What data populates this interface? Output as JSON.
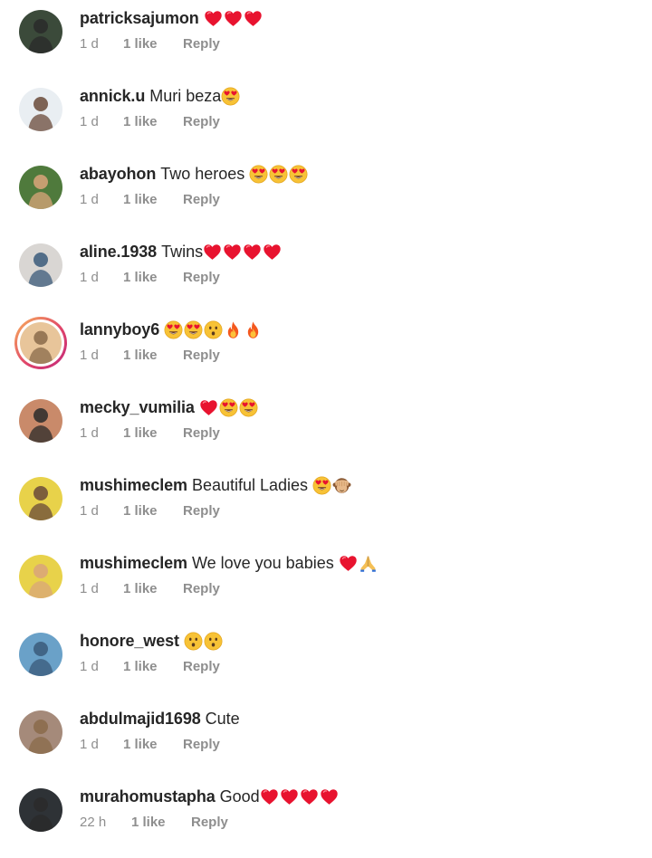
{
  "comments": [
    {
      "username": "patricksajumon",
      "text": "",
      "emojis": [
        "red-heart",
        "red-heart",
        "red-heart"
      ],
      "time": "1 d",
      "likes": "1 like",
      "reply": "Reply",
      "avatar_color": "#3b4a3a",
      "story": false
    },
    {
      "username": "annick.u",
      "text": "Muri beza",
      "emojis": [
        "heart-eyes"
      ],
      "time": "1 d",
      "likes": "1 like",
      "reply": "Reply",
      "avatar_color": "#e9eef2",
      "story": false
    },
    {
      "username": "abayohon",
      "text": "Two heroes",
      "emojis": [
        "heart-eyes",
        "heart-eyes",
        "heart-eyes"
      ],
      "time": "1 d",
      "likes": "1 like",
      "reply": "Reply",
      "avatar_color": "#4f7a3c",
      "story": false
    },
    {
      "username": "aline.1938",
      "text": "Twins",
      "emojis": [
        "red-heart",
        "red-heart",
        "red-heart",
        "red-heart"
      ],
      "time": "1 d",
      "likes": "1 like",
      "reply": "Reply",
      "avatar_color": "#d9d6d3",
      "story": false
    },
    {
      "username": "lannyboy6",
      "text": "",
      "emojis": [
        "heart-eyes",
        "heart-eyes",
        "hushed",
        "fire",
        "fire"
      ],
      "time": "1 d",
      "likes": "1 like",
      "reply": "Reply",
      "avatar_color": "#e8c59a",
      "story": true
    },
    {
      "username": "mecky_vumilia",
      "text": "",
      "emojis": [
        "red-heart",
        "heart-eyes",
        "heart-eyes"
      ],
      "time": "1 d",
      "likes": "1 like",
      "reply": "Reply",
      "avatar_color": "#c98a6a",
      "story": false
    },
    {
      "username": "mushimeclem",
      "text": "Beautiful Ladies",
      "emojis": [
        "heart-eyes",
        "see-no-evil"
      ],
      "time": "1 d",
      "likes": "1 like",
      "reply": "Reply",
      "avatar_color": "#e8d24a",
      "story": false
    },
    {
      "username": "mushimeclem",
      "text": "We love you babies",
      "emojis": [
        "red-heart",
        "folded-hands"
      ],
      "time": "1 d",
      "likes": "1 like",
      "reply": "Reply",
      "avatar_color": "#e8d24a",
      "story": false
    },
    {
      "username": "honore_west",
      "text": "",
      "emojis": [
        "hushed",
        "hushed"
      ],
      "time": "1 d",
      "likes": "1 like",
      "reply": "Reply",
      "avatar_color": "#6aa1c8",
      "story": false
    },
    {
      "username": "abdulmajid1698",
      "text": "Cute",
      "emojis": [],
      "time": "1 d",
      "likes": "1 like",
      "reply": "Reply",
      "avatar_color": "#a58a7a",
      "story": false
    },
    {
      "username": "murahomustapha",
      "text": "Good",
      "emojis": [
        "red-heart",
        "red-heart",
        "red-heart",
        "red-heart"
      ],
      "time": "22 h",
      "likes": "1 like",
      "reply": "Reply",
      "avatar_color": "#2e3236",
      "story": false
    }
  ]
}
